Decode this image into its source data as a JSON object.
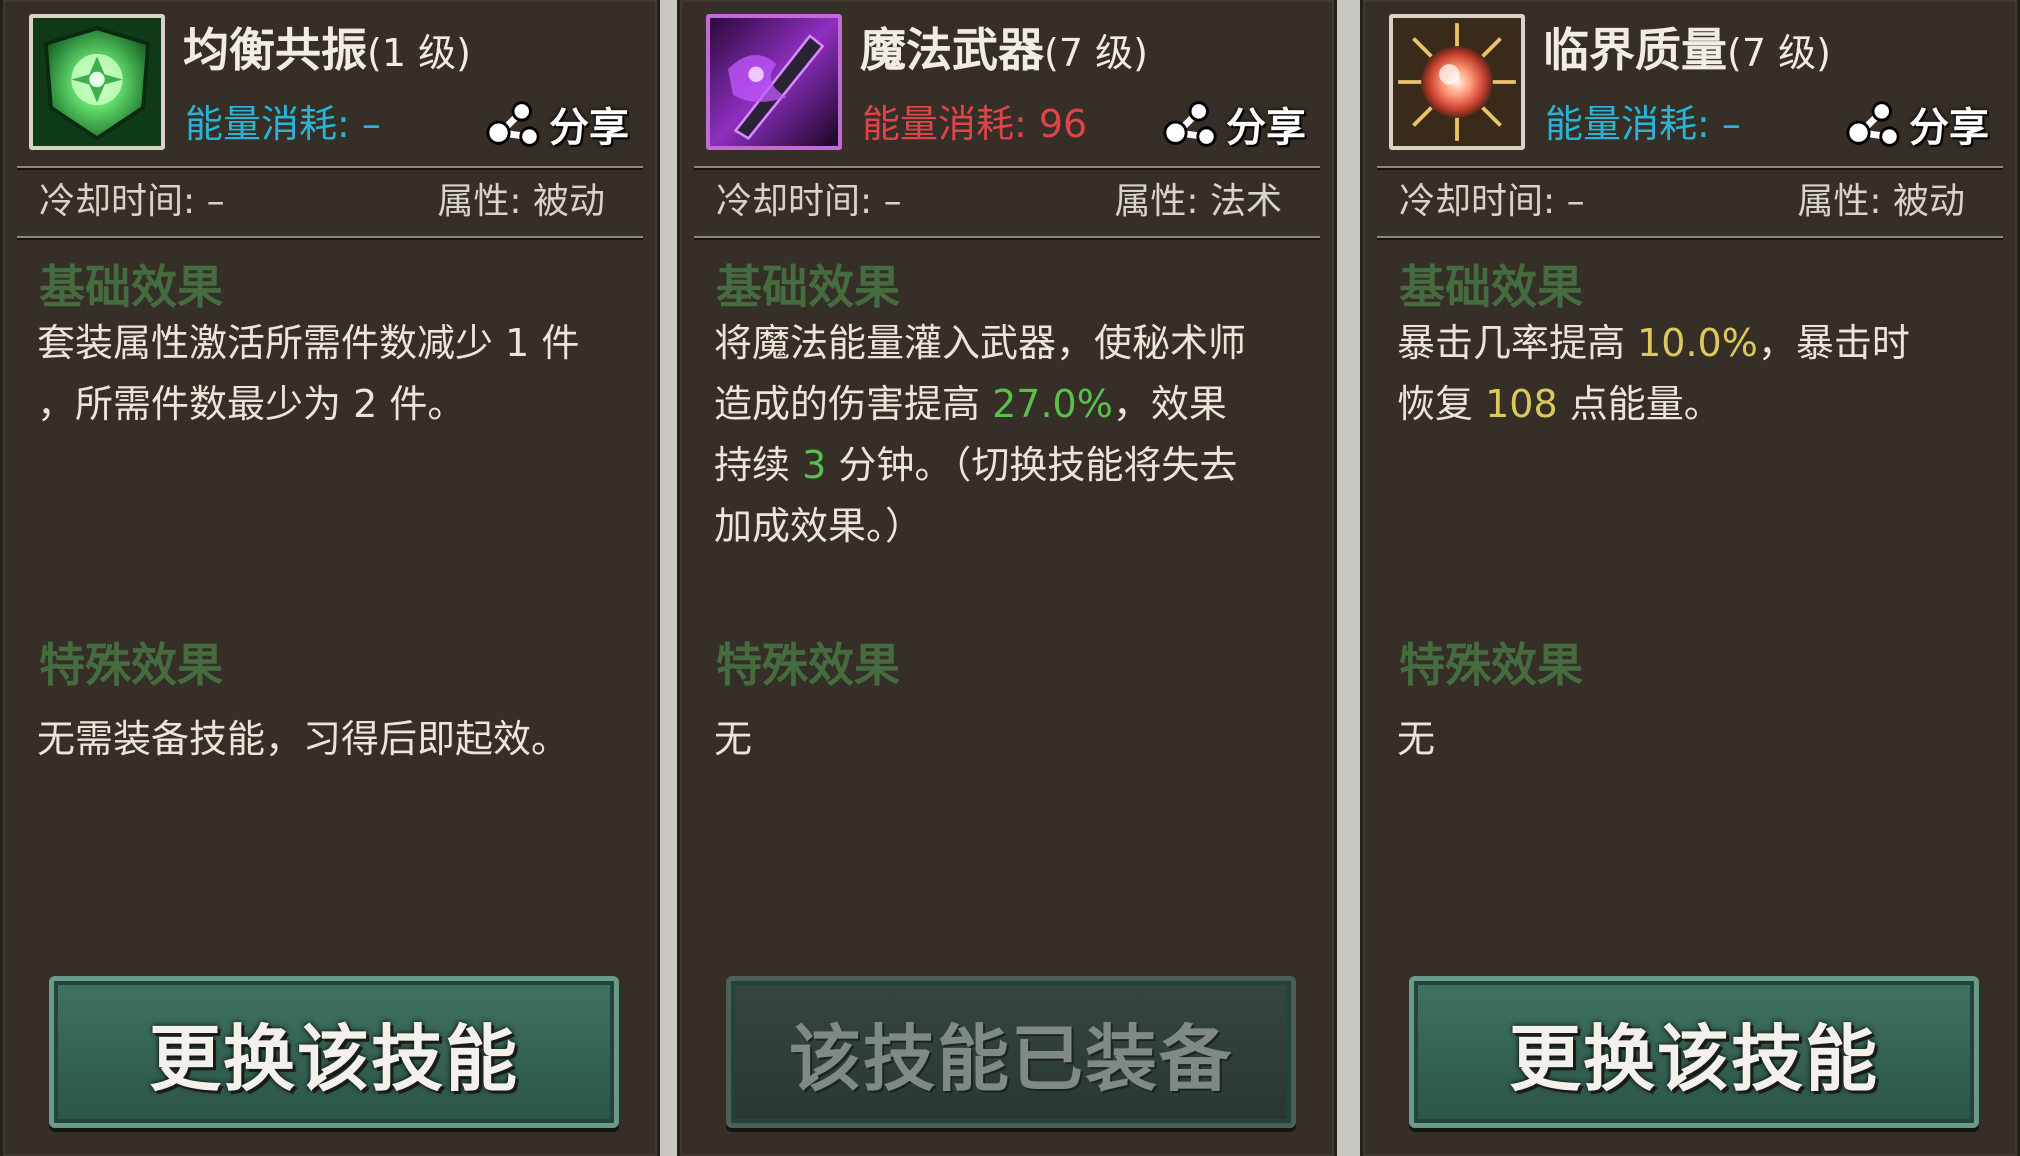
{
  "cards": [
    {
      "name": "均衡共振",
      "level": "(1 级)",
      "energy": "能量消耗: –",
      "energy_color": "#29b4d6",
      "share": "分享",
      "cooldown": "冷却时间: –",
      "attribute": "属性: 被动",
      "base_heading": "基础效果",
      "base_text": [
        "套装属性激活所需件数减少 1 件",
        "，所需件数最少为 2 件。"
      ],
      "special_heading": "特殊效果",
      "special_text": "无需装备技能，习得后即起效。",
      "button": "更换该技能",
      "icon": "green-resonance-icon"
    },
    {
      "name": "魔法武器",
      "level": "(7 级)",
      "energy": "能量消耗: 96",
      "energy_color": "#e0444a",
      "share": "分享",
      "cooldown": "冷却时间: –",
      "attribute": "属性: 法术",
      "base_heading": "基础效果",
      "base_text": {
        "line1": "将魔法能量灌入武器，使秘术师",
        "line2_pre": "造成的伤害提高 ",
        "line2_value": "27.0%",
        "line2_post": "，效果",
        "line3_pre": "持续 ",
        "line3_value": "3",
        "line3_post": " 分钟。（切换技能将失去",
        "line4": "加成效果。）"
      },
      "special_heading": "特殊效果",
      "special_text": "无",
      "button": "该技能已装备",
      "icon": "purple-magic-weapon-icon"
    },
    {
      "name": "临界质量",
      "level": "(7 级)",
      "energy": "能量消耗: –",
      "energy_color": "#29b4d6",
      "share": "分享",
      "cooldown": "冷却时间: –",
      "attribute": "属性: 被动",
      "base_heading": "基础效果",
      "base_text": {
        "line1_pre": "暴击几率提高 ",
        "line1_value": "10.0%",
        "line1_post": "，暴击时",
        "line2_pre": "恢复 ",
        "line2_value": "108",
        "line2_post": " 点能量。"
      },
      "special_heading": "特殊效果",
      "special_text": "无",
      "button": "更换该技能",
      "icon": "critical-mass-orb-icon"
    }
  ]
}
